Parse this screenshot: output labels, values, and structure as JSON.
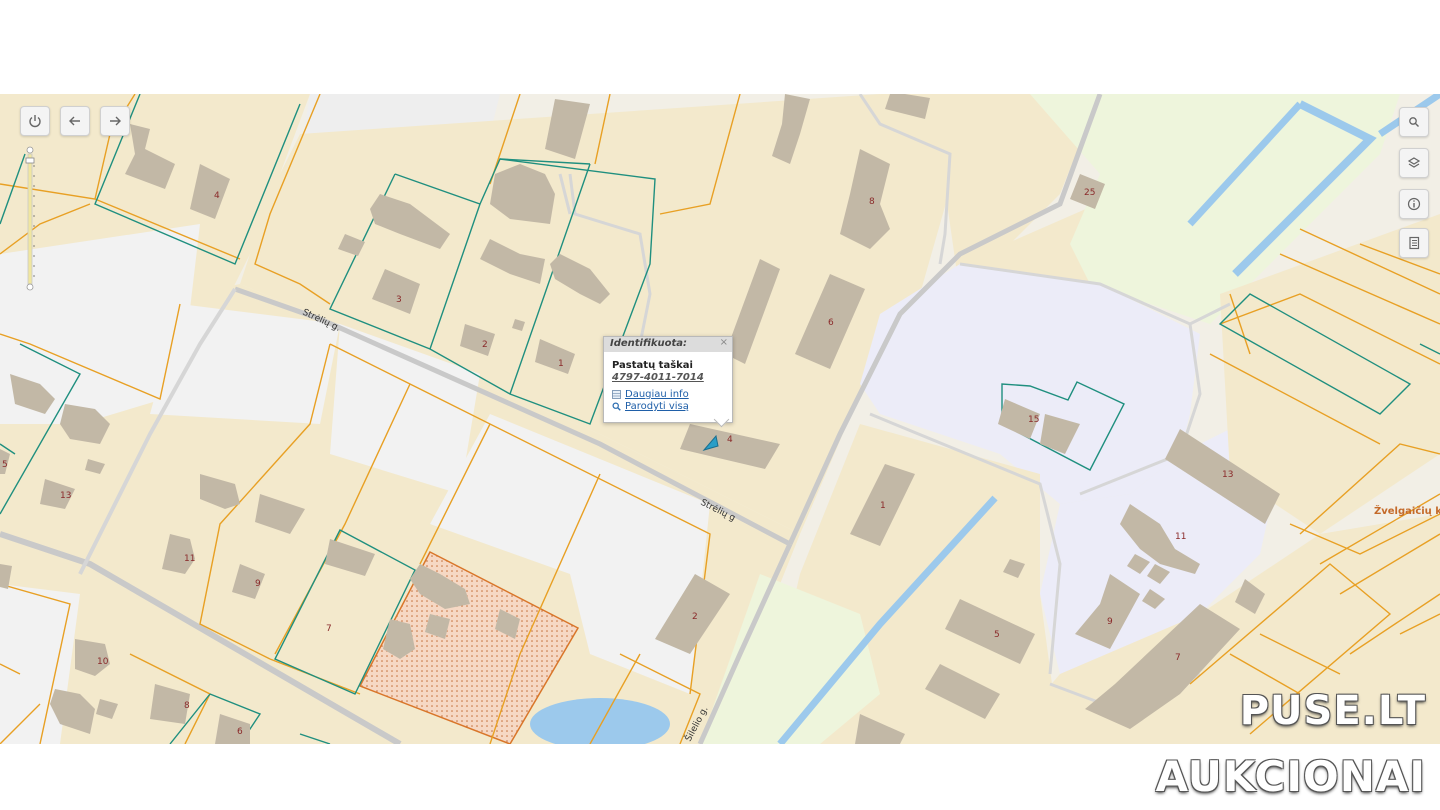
{
  "map": {
    "streets": [
      "Strėlių g.",
      "Strėlių g",
      "Šilelio g."
    ],
    "place_label": "Žvelgaičių k",
    "building_numbers": [
      "4",
      "3",
      "2",
      "1",
      "8",
      "25",
      "6",
      "15",
      "13",
      "11",
      "1",
      "2",
      "9",
      "11",
      "7",
      "10",
      "8",
      "6",
      "9",
      "5",
      "7",
      "5",
      "13",
      "4"
    ],
    "colors": {
      "background": "#f2efe6",
      "parcel_fill": "#f3e9cc",
      "building": "#c2b8a6",
      "orange_boundary": "#e8a024",
      "green_boundary": "#1f8f7f",
      "water": "#9cc9ec",
      "industrial": "#ececf8",
      "park": "#eef5dc",
      "road": "#d2d2d2"
    }
  },
  "controls": {
    "power_icon": "power-icon",
    "back_icon": "arrow-left-icon",
    "forward_icon": "arrow-right-icon",
    "search_icon": "search-icon",
    "layers_icon": "layers-icon",
    "info_icon": "info-icon",
    "document_icon": "document-icon"
  },
  "popup": {
    "header": "Identifikuota:",
    "close": "×",
    "type": "Pastatų taškai",
    "id": "4797-4011-7014",
    "more_info": "Daugiau info",
    "show_all": "Parodyti visą"
  },
  "watermark": {
    "line1": "PUSE.LT",
    "line2": "AUKCIONAI"
  }
}
